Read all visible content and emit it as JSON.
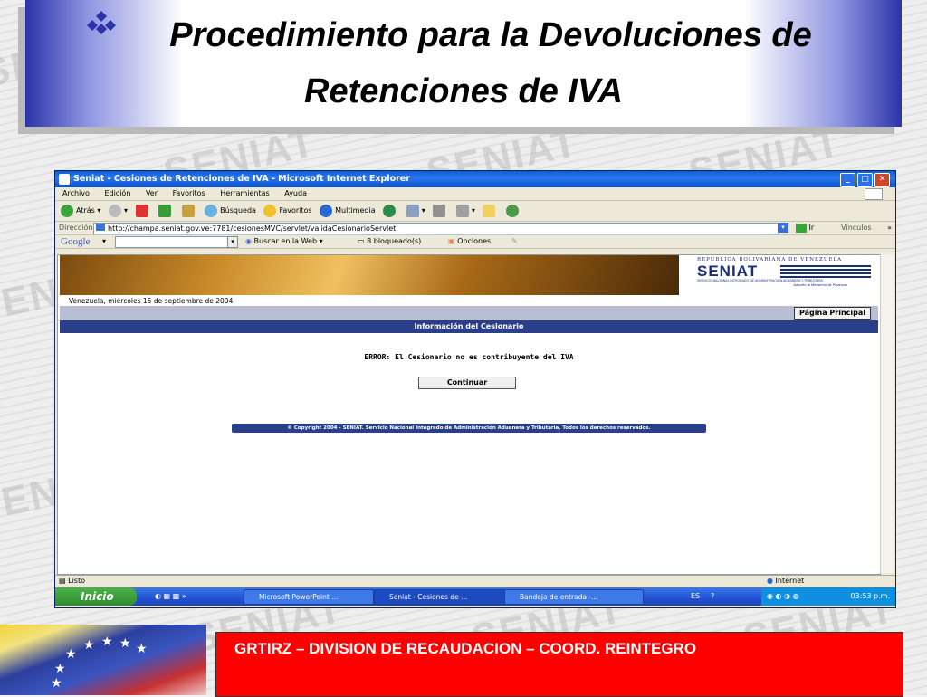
{
  "slide": {
    "title_line1": "Procedimiento para la Devoluciones de",
    "title_line2": "Retenciones de IVA",
    "watermark": "SENIAT",
    "footer": "GRTIRZ – DIVISION DE RECAUDACION – COORD. REINTEGRO",
    "colors": {
      "title_blue": "#2a34a8",
      "footer_red": "#ff0000"
    }
  },
  "browser": {
    "title": "Seniat - Cesiones de Retenciones de IVA - Microsoft Internet Explorer",
    "menu": [
      "Archivo",
      "Edición",
      "Ver",
      "Favoritos",
      "Herramientas",
      "Ayuda"
    ],
    "toolbar": {
      "back": "Atrás",
      "search": "Búsqueda",
      "favorites": "Favoritos",
      "multimedia": "Multimedia"
    },
    "address_label": "Dirección",
    "address_url": "http://champa.seniat.gov.ve:7781/cesionesMVC/servlet/validaCesionarioServlet",
    "go": "Ir",
    "links": "Vínculos",
    "google": {
      "logo": "Google",
      "search_web": "Buscar en la Web",
      "blocked": "8 bloqueado(s)",
      "options": "Opciones"
    }
  },
  "page": {
    "date": "Venezuela,  miércoles 15 de septiembre de 2004",
    "seniat_header": "REPUBLICA BOLIVARIANA DE VENEZUELA",
    "seniat_logo": "SENIAT",
    "seniat_sub1": "SERVICIO NACIONAL INTEGRADO DE ADMINISTRACION ADUANERA Y TRIBUTARIA",
    "seniat_sub2": "Adscrito al Ministerio de Finanzas",
    "home_button": "Página Principal",
    "section_title": "Información del Cesionario",
    "error": "ERROR: El Cesionario no es contribuyente del IVA",
    "continue_button": "Continuar",
    "copyright": "© Copyright 2004 - SENIAT. Servicio Nacional Integrado de Administración Aduanera y Tributaria. Todos los derechos reservados."
  },
  "status": {
    "left": "Listo",
    "zone": "Internet"
  },
  "taskbar": {
    "start": "Inicio",
    "items": [
      "Microsoft PowerPoint ...",
      "Seniat - Cesiones de ...",
      "Bandeja de entrada -..."
    ],
    "lang": "ES",
    "clock": "03:53 p.m."
  }
}
